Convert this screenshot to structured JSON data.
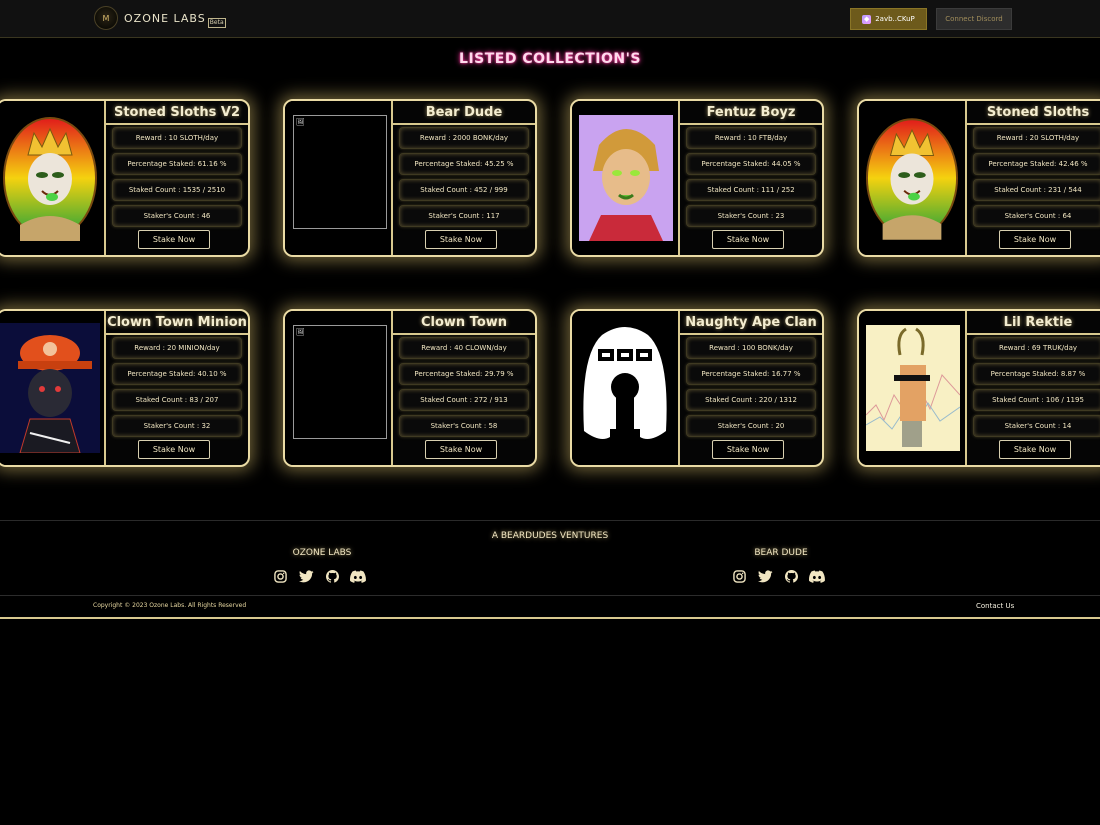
{
  "header": {
    "logo_mark": "M",
    "brand": "OZONE LABS",
    "beta": "Beta",
    "wallet_label": "2avb..CKuP",
    "discord_label": "Connect Discord"
  },
  "page_title": "LISTED COLLECTION'S",
  "collections": [
    {
      "name": "Stoned Sloths V2",
      "reward": "Reward : 10 SLOTH/day",
      "percentage": "Percentage Staked: 61.16 %",
      "staked": "Staked Count : 1535 / 2510",
      "stakers": "Staker's Count : 46",
      "button": "Stake Now",
      "image": "sloth-king"
    },
    {
      "name": "Bear Dude",
      "reward": "Reward : 2000 BONK/day",
      "percentage": "Percentage Staked: 45.25 %",
      "staked": "Staked Count : 452 / 999",
      "stakers": "Staker's Count : 117",
      "button": "Stake Now",
      "image": "broken"
    },
    {
      "name": "Fentuz Boyz",
      "reward": "Reward : 10 FTB/day",
      "percentage": "Percentage Staked: 44.05 %",
      "staked": "Staked Count : 111 / 252",
      "stakers": "Staker's Count : 23",
      "button": "Stake Now",
      "image": "fentuz-boy"
    },
    {
      "name": "Stoned Sloths",
      "reward": "Reward : 20 SLOTH/day",
      "percentage": "Percentage Staked: 42.46 %",
      "staked": "Staked Count : 231 / 544",
      "stakers": "Staker's Count : 64",
      "button": "Stake Now",
      "image": "sloth-king"
    },
    {
      "name": "Clown Town Minion",
      "reward": "Reward : 20 MINION/day",
      "percentage": "Percentage Staked: 40.10 %",
      "staked": "Staked Count : 83 / 207",
      "stakers": "Staker's Count : 32",
      "button": "Stake Now",
      "image": "clown-minion"
    },
    {
      "name": "Clown Town",
      "reward": "Reward : 40 CLOWN/day",
      "percentage": "Percentage Staked: 29.79 %",
      "staked": "Staked Count : 272 / 913",
      "stakers": "Staker's Count : 58",
      "button": "Stake Now",
      "image": "broken"
    },
    {
      "name": "Naughty Ape Clan",
      "reward": "Reward : 100 BONK/day",
      "percentage": "Percentage Staked: 16.77 %",
      "staked": "Staked Count : 220 / 1312",
      "stakers": "Staker's Count : 20",
      "button": "Stake Now",
      "image": "nac-logo"
    },
    {
      "name": "Lil Rektie",
      "reward": "Reward : 69 TRUK/day",
      "percentage": "Percentage Staked: 8.87 %",
      "staked": "Staked Count : 106 / 1195",
      "stakers": "Staker's Count : 14",
      "button": "Stake Now",
      "image": "lil-rektie"
    }
  ],
  "footer": {
    "venture": "A BEARDUDES VENTURES",
    "col1_title": "OZONE LABS",
    "col2_title": "BEAR DUDE",
    "social_icons": [
      "instagram-icon",
      "twitter-icon",
      "github-icon",
      "discord-icon"
    ],
    "copyright": "Copyright © 2023 Ozone Labs. All Rights Reserved",
    "contact": "Contact Us"
  }
}
